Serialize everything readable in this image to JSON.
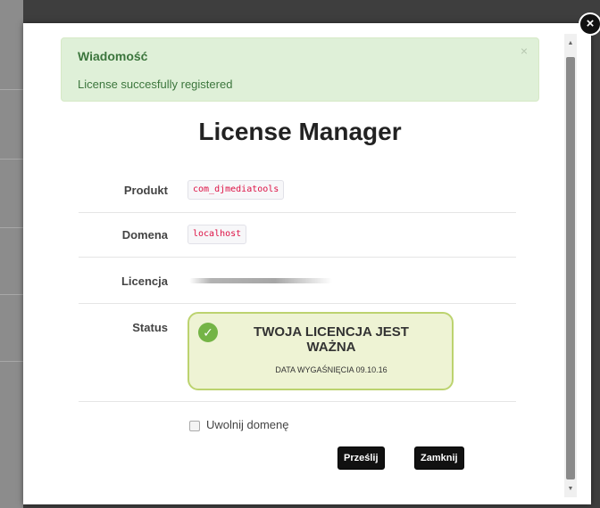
{
  "dialog": {
    "alert": {
      "heading": "Wiadomość",
      "message": "License succesfully registered",
      "close": "×"
    },
    "title": "License Manager",
    "rows": {
      "product": {
        "label": "Produkt",
        "value": "com_djmediatools"
      },
      "domain": {
        "label": "Domena",
        "value": "localhost"
      },
      "license": {
        "label": "Licencja"
      },
      "status": {
        "label": "Status"
      }
    },
    "status_box": {
      "title": "TWOJA LICENCJA JEST WAŻNA",
      "expiry": "DATA WYGAŚNIĘCIA 09.10.16",
      "check_icon": "check-circle-icon",
      "color": "#74b446"
    },
    "release_domain": {
      "label": "Uwolnij domenę",
      "checked": false
    },
    "buttons": {
      "submit": "Prześlij",
      "close": "Zamknij"
    },
    "close_icon": "×"
  },
  "colors": {
    "alert_bg": "#dff0d8",
    "alert_text": "#3c763d",
    "code_text": "#dd1144",
    "status_bg": "#eef3d4",
    "status_border": "#bcd36f",
    "button_bg": "#111111"
  }
}
